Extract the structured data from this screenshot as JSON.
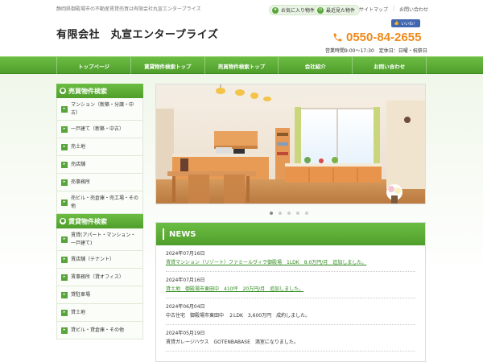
{
  "header": {
    "tagline": "静岡県御殿場市の不動産賃貸売買は有限会社丸宣エンタープライズ",
    "favorites_label": "お気に入り物件",
    "recent_label": "最近見た物件",
    "util_links": [
      "サイトマップ",
      "お問い合わせ"
    ],
    "fb_like": "いいね！",
    "company_name": "有限会社　丸宣エンタープライズ",
    "phone": "0550-84-2655",
    "hours": "営業時間9:00～17:30　定休日：日曜・祝祭日"
  },
  "nav": [
    "トップページ",
    "賃貸物件検索トップ",
    "売買物件検索トップ",
    "会社紹介",
    "お問い合わせ"
  ],
  "sidebar": {
    "sale_heading": "売買物件検索",
    "sale_items": [
      "マンション（新築・分譲・中古）",
      "一戸建て（新築・中古）",
      "売土地",
      "売店舗",
      "売事務所",
      "売ビル・売倉庫・売工場・その他"
    ],
    "rent_heading": "賃貸物件検索",
    "rent_items": [
      "賃貸(アパート・マンション・一戸建て)",
      "賃店舗（テナント）",
      "賃事務所（貸オフィス）",
      "貸駐車場",
      "貸土地",
      "貸ビル・貸倉庫・その他"
    ]
  },
  "slider": {
    "dot_count": 5,
    "active_index": 0
  },
  "news": {
    "title": "NEWS",
    "items": [
      {
        "date": "2024年07月16日",
        "text": "賃貸マンション（リゾート）ファミールヴィラ御殿場　1LDK　8.0万円/月　追加しました。",
        "link": true
      },
      {
        "date": "2024年07月16日",
        "text": "貸土地　御殿場市東田中　410坪　20万円/月　追加しました。",
        "link": true
      },
      {
        "date": "2024年06月04日",
        "text": "中古住宅　御殿場市東田中　２LDK　3,600万円　成約しました。",
        "link": false
      },
      {
        "date": "2024年05月19日",
        "text": "賃貸ガレージハウス　GOTENBABASE　満室になりました。",
        "link": false
      }
    ]
  },
  "colors": {
    "accent_green": "#56a43a",
    "phone_orange": "#ef8a1c",
    "link_green": "#2d8a1c"
  }
}
